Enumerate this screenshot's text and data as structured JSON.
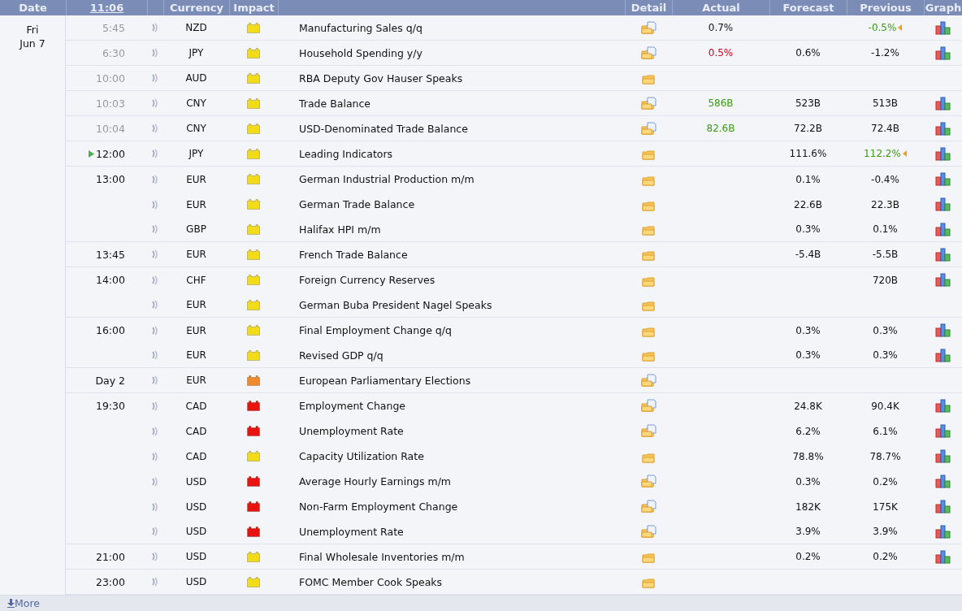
{
  "header": {
    "date": "Date",
    "time": "11:06",
    "currency": "Currency",
    "impact": "Impact",
    "detail": "Detail",
    "actual": "Actual",
    "forecast": "Forecast",
    "previous": "Previous",
    "graph": "Graph"
  },
  "date": {
    "weekday": "Fri",
    "day": "Jun 7"
  },
  "groups": [
    {
      "time": "5:45",
      "past": true,
      "next": false,
      "events": [
        {
          "currency": "NZD",
          "impact": {
            "color": "#f2dc1a"
          },
          "title": "Manufacturing Sales q/q",
          "document": true,
          "actual": {
            "text": "0.7%",
            "color": "#111111"
          },
          "previous": {
            "text": "-0.5%",
            "color": "#3c9a17",
            "revised": true
          },
          "graph": true
        }
      ]
    },
    {
      "time": "6:30",
      "past": true,
      "next": false,
      "events": [
        {
          "currency": "JPY",
          "impact": {
            "color": "#f2dc1a"
          },
          "title": "Household Spending y/y",
          "document": true,
          "actual": {
            "text": "0.5%",
            "color": "#d6001c"
          },
          "forecast": "0.6%",
          "previous": {
            "text": "-1.2%",
            "color": "#111111",
            "revised": false
          },
          "graph": true
        }
      ]
    },
    {
      "time": "10:00",
      "past": true,
      "next": false,
      "events": [
        {
          "currency": "AUD",
          "impact": {
            "color": "#f2dc1a"
          },
          "title": "RBA Deputy Gov Hauser Speaks",
          "document": false,
          "graph": false
        }
      ]
    },
    {
      "time": "10:03",
      "past": true,
      "next": false,
      "events": [
        {
          "currency": "CNY",
          "impact": {
            "color": "#f2dc1a"
          },
          "title": "Trade Balance",
          "document": true,
          "actual": {
            "text": "586B",
            "color": "#3c9a17"
          },
          "forecast": "523B",
          "previous": {
            "text": "513B",
            "color": "#111111",
            "revised": false
          },
          "graph": true
        }
      ]
    },
    {
      "time": "10:04",
      "past": true,
      "next": false,
      "events": [
        {
          "currency": "CNY",
          "impact": {
            "color": "#f2dc1a"
          },
          "title": "USD-Denominated Trade Balance",
          "document": true,
          "actual": {
            "text": "82.6B",
            "color": "#3c9a17"
          },
          "forecast": "72.2B",
          "previous": {
            "text": "72.4B",
            "color": "#111111",
            "revised": false
          },
          "graph": true
        }
      ]
    },
    {
      "time": "12:00",
      "past": false,
      "next": true,
      "events": [
        {
          "currency": "JPY",
          "impact": {
            "color": "#f2dc1a"
          },
          "title": "Leading Indicators",
          "document": false,
          "forecast": "111.6%",
          "previous": {
            "text": "112.2%",
            "color": "#3c9a17",
            "revised": true
          },
          "graph": true
        }
      ]
    },
    {
      "time": "13:00",
      "past": false,
      "next": false,
      "events": [
        {
          "currency": "EUR",
          "impact": {
            "color": "#f2dc1a"
          },
          "title": "German Industrial Production m/m",
          "document": false,
          "forecast": "0.1%",
          "previous": {
            "text": "-0.4%",
            "color": "#111111",
            "revised": false
          },
          "graph": true
        },
        {
          "currency": "EUR",
          "impact": {
            "color": "#f2dc1a"
          },
          "title": "German Trade Balance",
          "document": false,
          "forecast": "22.6B",
          "previous": {
            "text": "22.3B",
            "color": "#111111",
            "revised": false
          },
          "graph": true
        },
        {
          "currency": "GBP",
          "impact": {
            "color": "#f2dc1a"
          },
          "title": "Halifax HPI m/m",
          "document": false,
          "forecast": "0.3%",
          "previous": {
            "text": "0.1%",
            "color": "#111111",
            "revised": false
          },
          "graph": true
        }
      ]
    },
    {
      "time": "13:45",
      "past": false,
      "next": false,
      "events": [
        {
          "currency": "EUR",
          "impact": {
            "color": "#f2dc1a"
          },
          "title": "French Trade Balance",
          "document": false,
          "forecast": "-5.4B",
          "previous": {
            "text": "-5.5B",
            "color": "#111111",
            "revised": false
          },
          "graph": true
        }
      ]
    },
    {
      "time": "14:00",
      "past": false,
      "next": false,
      "events": [
        {
          "currency": "CHF",
          "impact": {
            "color": "#f2dc1a"
          },
          "title": "Foreign Currency Reserves",
          "document": false,
          "previous": {
            "text": "720B",
            "color": "#111111",
            "revised": false
          },
          "graph": true
        },
        {
          "currency": "EUR",
          "impact": {
            "color": "#f2dc1a"
          },
          "title": "German Buba President Nagel Speaks",
          "document": false,
          "graph": false
        }
      ]
    },
    {
      "time": "16:00",
      "past": false,
      "next": false,
      "events": [
        {
          "currency": "EUR",
          "impact": {
            "color": "#f2dc1a"
          },
          "title": "Final Employment Change q/q",
          "document": false,
          "forecast": "0.3%",
          "previous": {
            "text": "0.3%",
            "color": "#111111",
            "revised": false
          },
          "graph": true
        },
        {
          "currency": "EUR",
          "impact": {
            "color": "#f2dc1a"
          },
          "title": "Revised GDP q/q",
          "document": false,
          "forecast": "0.3%",
          "previous": {
            "text": "0.3%",
            "color": "#111111",
            "revised": false
          },
          "graph": true
        }
      ]
    },
    {
      "time": "Day 2",
      "past": false,
      "next": false,
      "events": [
        {
          "currency": "EUR",
          "impact": {
            "color": "#f08a2c"
          },
          "title": "European Parliamentary Elections",
          "document": true,
          "graph": false
        }
      ]
    },
    {
      "time": "19:30",
      "past": false,
      "next": false,
      "events": [
        {
          "currency": "CAD",
          "impact": {
            "color": "#e8120f"
          },
          "title": "Employment Change",
          "document": true,
          "forecast": "24.8K",
          "previous": {
            "text": "90.4K",
            "color": "#111111",
            "revised": false
          },
          "graph": true
        },
        {
          "currency": "CAD",
          "impact": {
            "color": "#e8120f"
          },
          "title": "Unemployment Rate",
          "document": true,
          "forecast": "6.2%",
          "previous": {
            "text": "6.1%",
            "color": "#111111",
            "revised": false
          },
          "graph": true
        },
        {
          "currency": "CAD",
          "impact": {
            "color": "#f2dc1a"
          },
          "title": "Capacity Utilization Rate",
          "document": false,
          "forecast": "78.8%",
          "previous": {
            "text": "78.7%",
            "color": "#111111",
            "revised": false
          },
          "graph": true
        },
        {
          "currency": "USD",
          "impact": {
            "color": "#e8120f"
          },
          "title": "Average Hourly Earnings m/m",
          "document": true,
          "forecast": "0.3%",
          "previous": {
            "text": "0.2%",
            "color": "#111111",
            "revised": false
          },
          "graph": true
        },
        {
          "currency": "USD",
          "impact": {
            "color": "#e8120f"
          },
          "title": "Non-Farm Employment Change",
          "document": true,
          "forecast": "182K",
          "previous": {
            "text": "175K",
            "color": "#111111",
            "revised": false
          },
          "graph": true
        },
        {
          "currency": "USD",
          "impact": {
            "color": "#e8120f"
          },
          "title": "Unemployment Rate",
          "document": true,
          "forecast": "3.9%",
          "previous": {
            "text": "3.9%",
            "color": "#111111",
            "revised": false
          },
          "graph": true
        }
      ]
    },
    {
      "time": "21:00",
      "past": false,
      "next": false,
      "events": [
        {
          "currency": "USD",
          "impact": {
            "color": "#f2dc1a"
          },
          "title": "Final Wholesale Inventories m/m",
          "document": false,
          "forecast": "0.2%",
          "previous": {
            "text": "0.2%",
            "color": "#111111",
            "revised": false
          },
          "graph": true
        }
      ]
    },
    {
      "time": "23:00",
      "past": false,
      "next": false,
      "events": [
        {
          "currency": "USD",
          "impact": {
            "color": "#f2dc1a"
          },
          "title": "FOMC Member Cook Speaks",
          "document": false,
          "graph": false
        }
      ]
    }
  ],
  "more": "More"
}
